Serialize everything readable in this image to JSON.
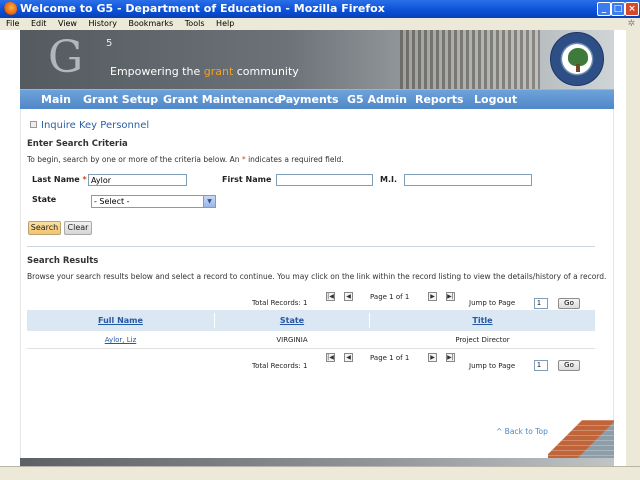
{
  "window": {
    "title": "Welcome to G5 - Department of Education - Mozilla Firefox",
    "min": "_",
    "max": "□",
    "close": "×"
  },
  "menu": [
    "File",
    "Edit",
    "View",
    "History",
    "Bookmarks",
    "Tools",
    "Help"
  ],
  "header": {
    "logo_letter": "G",
    "logo_super": "5",
    "tagline_pre": "Empowering the ",
    "tagline_accent": "grant",
    "tagline_post": " community"
  },
  "nav": [
    "Main",
    "Grant Setup",
    "Grant Maintenance",
    "Payments",
    "G5 Admin",
    "Reports",
    "Logout"
  ],
  "page": {
    "title": "Inquire Key Personnel",
    "criteria_heading": "Enter Search Criteria",
    "criteria_help_pre": "To begin, search by one or more of the criteria below. An ",
    "criteria_help_star": "*",
    "criteria_help_post": " indicates a required field."
  },
  "form": {
    "last_name_label": "Last Name",
    "required_star": "*",
    "last_name_value": "Aylor",
    "first_name_label": "First Name",
    "first_name_value": "",
    "mi_label": "M.I.",
    "mi_value": "",
    "state_label": "State",
    "state_value": "- Select -",
    "search_button": "Search",
    "clear_button": "Clear"
  },
  "results": {
    "heading": "Search Results",
    "help": "Browse your search results below and select a record to continue. You may click on the link within the record listing to view the details/history of a record.",
    "total_records": "Total Records: 1",
    "page_info": "Page 1 of 1",
    "jump_label": "Jump to Page",
    "jump_value": "1",
    "go_button": "Go",
    "columns": [
      "Full Name",
      "State",
      "Title"
    ],
    "rows": [
      {
        "full_name": "Aylor, Liz",
        "state": "VIRGINIA",
        "title": "Project Director"
      }
    ]
  },
  "footer": {
    "back_to_top": "^ Back to Top"
  }
}
